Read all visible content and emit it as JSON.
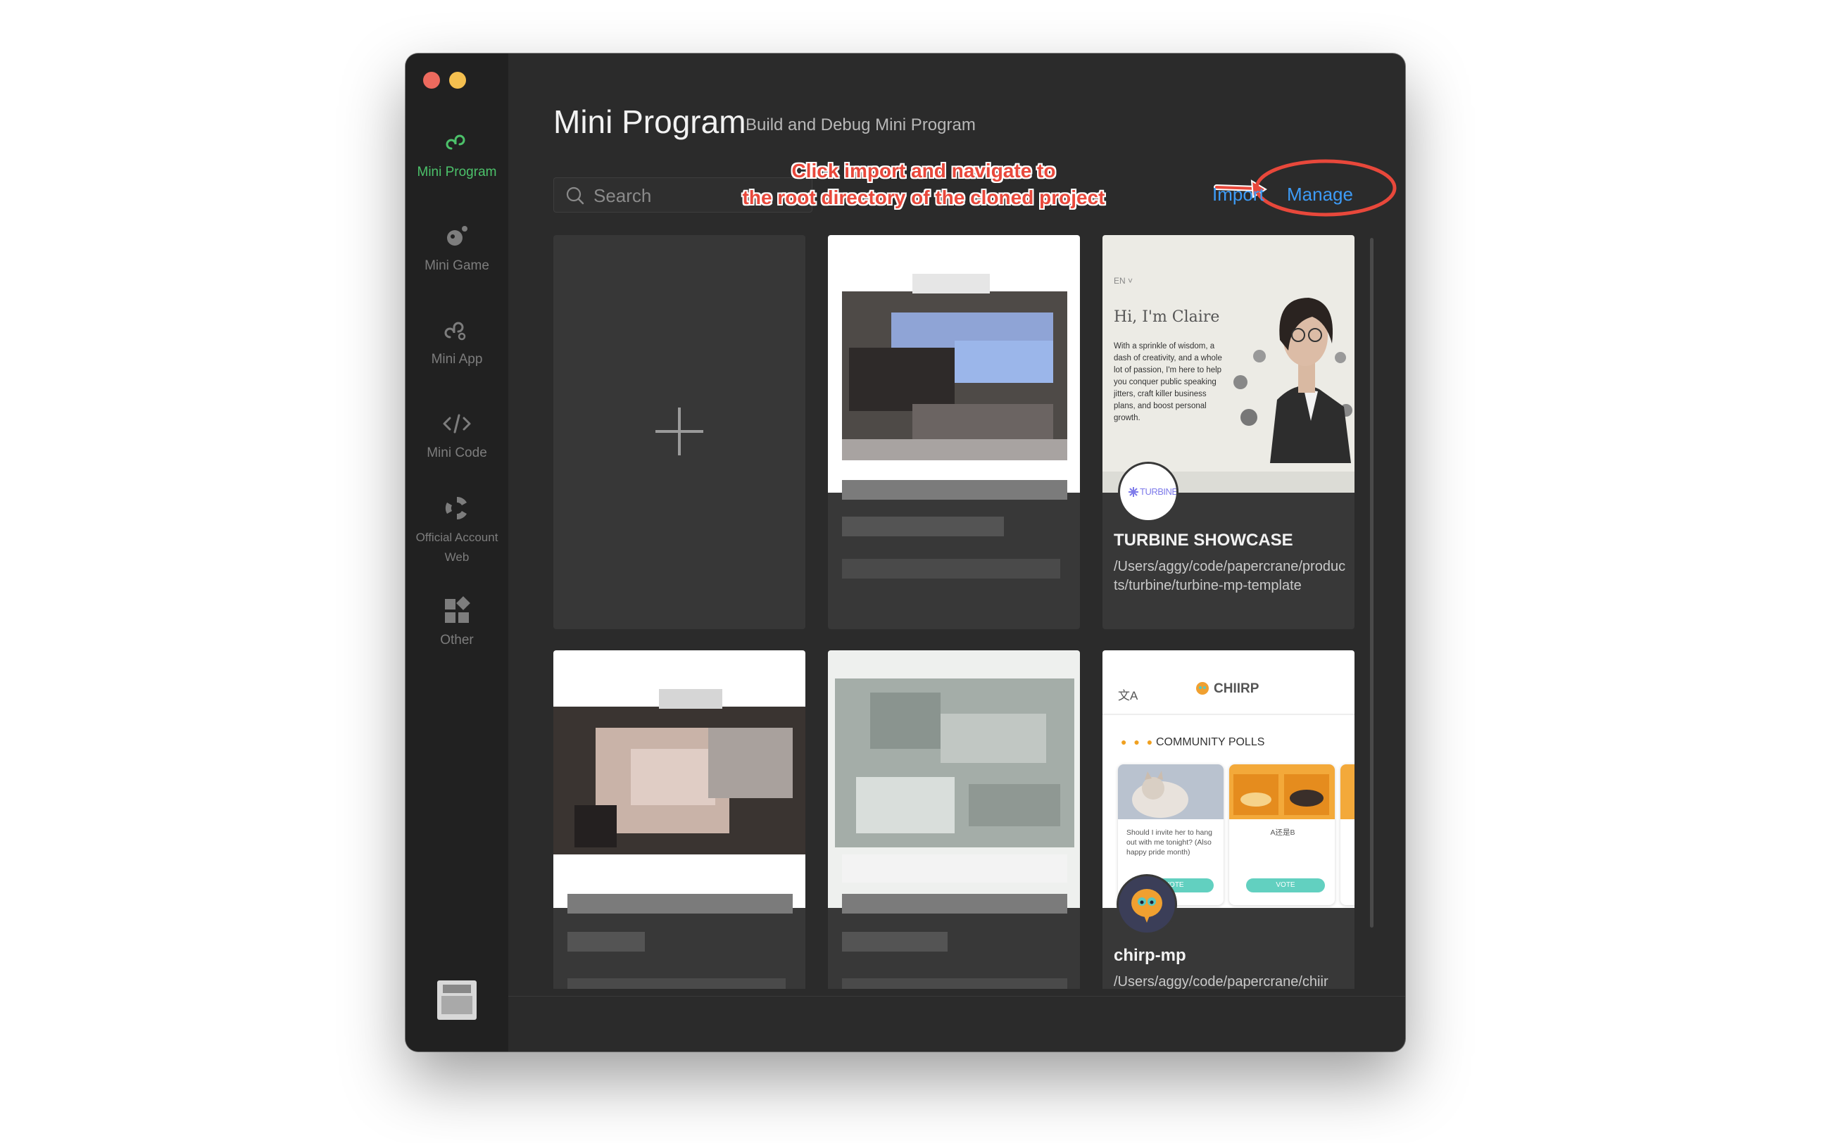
{
  "window": {
    "traffic_lights": [
      "close",
      "minimize"
    ]
  },
  "sidebar": {
    "items": [
      {
        "label": "Mini Program",
        "icon": "mini-program-icon",
        "active": true
      },
      {
        "label": "Mini Game",
        "icon": "mini-game-icon",
        "active": false
      },
      {
        "label": "Mini App",
        "icon": "mini-app-icon",
        "active": false
      },
      {
        "label": "Mini Code",
        "icon": "code-icon",
        "active": false
      },
      {
        "label": "Official Account Web",
        "icon": "official-account-icon",
        "active": false
      },
      {
        "label": "Other",
        "icon": "grid-icon",
        "active": false
      }
    ]
  },
  "header": {
    "title": "Mini Program",
    "subtitle": "Build and Debug Mini Program"
  },
  "search": {
    "placeholder": "Search",
    "value": ""
  },
  "actions": {
    "import_label": "Import",
    "manage_label": "Manage"
  },
  "annotation": {
    "line1": "Click import and navigate to",
    "line2": "the root directory of the cloned project"
  },
  "projects": [
    {
      "name": "TURBINE SHOWCASE",
      "path": "/Users/aggy/code/papercrane/products/turbine/turbine-mp-template"
    },
    {
      "name": "chirp-mp",
      "path": "/Users/aggy/code/papercrane/chiir"
    }
  ],
  "turbine_preview": {
    "lang": "EN ˅",
    "greeting": "Hi, I'm Claire",
    "body": "With a sprinkle of wisdom, a dash of creativity, and a whole lot of passion, I'm here to help you conquer public speaking jitters, craft killer business plans, and boost personal growth.",
    "logo": "TURBINE"
  },
  "chirp_preview": {
    "logo": "CHIIRP",
    "section": "COMMUNITY POLLS",
    "poll1_question": "Should I invite her to hang out with me tonight? (Also happy pride month)",
    "poll2_question": "A还是B",
    "vote_label": "VOTE"
  },
  "colors": {
    "accent_green": "#4cc16a",
    "link_blue": "#3d9bf6",
    "annotation_red": "#e8483b",
    "window_bg": "#2b2b2b",
    "sidebar_bg": "#212121"
  }
}
